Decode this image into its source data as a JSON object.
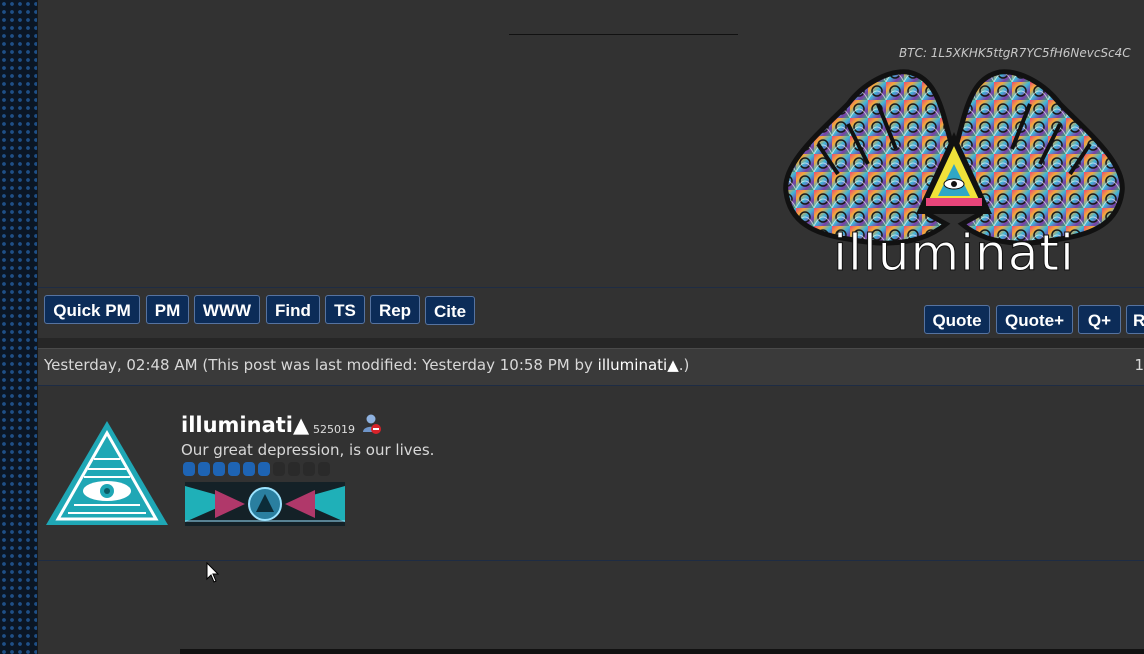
{
  "signature": {
    "btc_address": "BTC: 1L5XKHK5ttgR7YC5fH6NevcSc4C",
    "logo_text": "illuminati"
  },
  "post_buttons_left": [
    "Quick PM",
    "PM",
    "WWW",
    "Find",
    "TS",
    "Rep",
    "Cite"
  ],
  "post_buttons_right": [
    "Quote",
    "Quote+",
    "Q+",
    "R"
  ],
  "post": {
    "date": "Yesterday, 02:48 AM",
    "modified_prefix": "(This post was last modified: Yesterday 10:58 PM by ",
    "modified_by": "illuminati▲",
    "modified_suffix": ".)",
    "post_number": "1"
  },
  "author": {
    "username": "illuminati▲",
    "user_id": "525019",
    "user_title": "Our great depression, is our lives.",
    "reputation_filled": 6,
    "reputation_total": 10,
    "avatar_icon": "eye-pyramid-icon",
    "status_icon": "user-offline-icon"
  },
  "colors": {
    "button_bg": "#0c2c58",
    "page_bg": "#323232",
    "rep_on": "#1e64b4",
    "avatar_teal": "#1fa7b5"
  }
}
